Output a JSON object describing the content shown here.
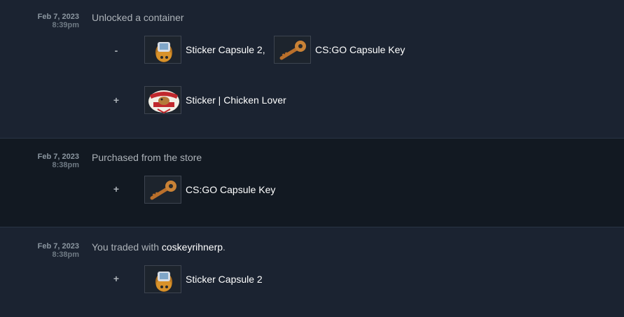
{
  "entries": [
    {
      "date": "Feb 7, 2023",
      "time": "8:39pm",
      "description": "Unlocked a container",
      "groups": [
        {
          "sign": "-",
          "items": [
            {
              "name": "Sticker Capsule 2,",
              "icon": "sticker-capsule-icon"
            },
            {
              "name": "CS:GO Capsule Key",
              "icon": "capsule-key-icon"
            }
          ]
        },
        {
          "sign": "+",
          "items": [
            {
              "name": "Sticker | Chicken Lover",
              "icon": "chicken-lover-sticker-icon"
            }
          ]
        }
      ]
    },
    {
      "date": "Feb 7, 2023",
      "time": "8:38pm",
      "description": "Purchased from the store",
      "groups": [
        {
          "sign": "+",
          "items": [
            {
              "name": "CS:GO Capsule Key",
              "icon": "capsule-key-icon"
            }
          ]
        }
      ]
    },
    {
      "date": "Feb 7, 2023",
      "time": "8:38pm",
      "description_prefix": "You traded with",
      "trade_partner": "coskeyrihnerp",
      "description_suffix": ".",
      "groups": [
        {
          "sign": "+",
          "items": [
            {
              "name": "Sticker Capsule 2",
              "icon": "sticker-capsule-icon"
            }
          ]
        }
      ]
    }
  ],
  "colors": {
    "row_bg": "#1b2331",
    "row_alt_bg": "#121922",
    "text_muted": "#acb2b8",
    "text_bright": "#ffffff"
  }
}
